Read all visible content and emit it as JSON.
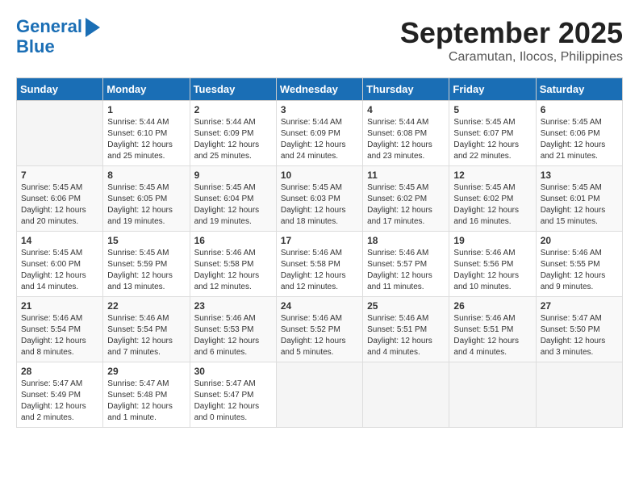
{
  "header": {
    "logo_line1": "General",
    "logo_line2": "Blue",
    "month": "September 2025",
    "location": "Caramutan, Ilocos, Philippines"
  },
  "days_of_week": [
    "Sunday",
    "Monday",
    "Tuesday",
    "Wednesday",
    "Thursday",
    "Friday",
    "Saturday"
  ],
  "weeks": [
    [
      {
        "day": "",
        "info": ""
      },
      {
        "day": "1",
        "info": "Sunrise: 5:44 AM\nSunset: 6:10 PM\nDaylight: 12 hours\nand 25 minutes."
      },
      {
        "day": "2",
        "info": "Sunrise: 5:44 AM\nSunset: 6:09 PM\nDaylight: 12 hours\nand 25 minutes."
      },
      {
        "day": "3",
        "info": "Sunrise: 5:44 AM\nSunset: 6:09 PM\nDaylight: 12 hours\nand 24 minutes."
      },
      {
        "day": "4",
        "info": "Sunrise: 5:44 AM\nSunset: 6:08 PM\nDaylight: 12 hours\nand 23 minutes."
      },
      {
        "day": "5",
        "info": "Sunrise: 5:45 AM\nSunset: 6:07 PM\nDaylight: 12 hours\nand 22 minutes."
      },
      {
        "day": "6",
        "info": "Sunrise: 5:45 AM\nSunset: 6:06 PM\nDaylight: 12 hours\nand 21 minutes."
      }
    ],
    [
      {
        "day": "7",
        "info": "Sunrise: 5:45 AM\nSunset: 6:06 PM\nDaylight: 12 hours\nand 20 minutes."
      },
      {
        "day": "8",
        "info": "Sunrise: 5:45 AM\nSunset: 6:05 PM\nDaylight: 12 hours\nand 19 minutes."
      },
      {
        "day": "9",
        "info": "Sunrise: 5:45 AM\nSunset: 6:04 PM\nDaylight: 12 hours\nand 19 minutes."
      },
      {
        "day": "10",
        "info": "Sunrise: 5:45 AM\nSunset: 6:03 PM\nDaylight: 12 hours\nand 18 minutes."
      },
      {
        "day": "11",
        "info": "Sunrise: 5:45 AM\nSunset: 6:02 PM\nDaylight: 12 hours\nand 17 minutes."
      },
      {
        "day": "12",
        "info": "Sunrise: 5:45 AM\nSunset: 6:02 PM\nDaylight: 12 hours\nand 16 minutes."
      },
      {
        "day": "13",
        "info": "Sunrise: 5:45 AM\nSunset: 6:01 PM\nDaylight: 12 hours\nand 15 minutes."
      }
    ],
    [
      {
        "day": "14",
        "info": "Sunrise: 5:45 AM\nSunset: 6:00 PM\nDaylight: 12 hours\nand 14 minutes."
      },
      {
        "day": "15",
        "info": "Sunrise: 5:45 AM\nSunset: 5:59 PM\nDaylight: 12 hours\nand 13 minutes."
      },
      {
        "day": "16",
        "info": "Sunrise: 5:46 AM\nSunset: 5:58 PM\nDaylight: 12 hours\nand 12 minutes."
      },
      {
        "day": "17",
        "info": "Sunrise: 5:46 AM\nSunset: 5:58 PM\nDaylight: 12 hours\nand 12 minutes."
      },
      {
        "day": "18",
        "info": "Sunrise: 5:46 AM\nSunset: 5:57 PM\nDaylight: 12 hours\nand 11 minutes."
      },
      {
        "day": "19",
        "info": "Sunrise: 5:46 AM\nSunset: 5:56 PM\nDaylight: 12 hours\nand 10 minutes."
      },
      {
        "day": "20",
        "info": "Sunrise: 5:46 AM\nSunset: 5:55 PM\nDaylight: 12 hours\nand 9 minutes."
      }
    ],
    [
      {
        "day": "21",
        "info": "Sunrise: 5:46 AM\nSunset: 5:54 PM\nDaylight: 12 hours\nand 8 minutes."
      },
      {
        "day": "22",
        "info": "Sunrise: 5:46 AM\nSunset: 5:54 PM\nDaylight: 12 hours\nand 7 minutes."
      },
      {
        "day": "23",
        "info": "Sunrise: 5:46 AM\nSunset: 5:53 PM\nDaylight: 12 hours\nand 6 minutes."
      },
      {
        "day": "24",
        "info": "Sunrise: 5:46 AM\nSunset: 5:52 PM\nDaylight: 12 hours\nand 5 minutes."
      },
      {
        "day": "25",
        "info": "Sunrise: 5:46 AM\nSunset: 5:51 PM\nDaylight: 12 hours\nand 4 minutes."
      },
      {
        "day": "26",
        "info": "Sunrise: 5:46 AM\nSunset: 5:51 PM\nDaylight: 12 hours\nand 4 minutes."
      },
      {
        "day": "27",
        "info": "Sunrise: 5:47 AM\nSunset: 5:50 PM\nDaylight: 12 hours\nand 3 minutes."
      }
    ],
    [
      {
        "day": "28",
        "info": "Sunrise: 5:47 AM\nSunset: 5:49 PM\nDaylight: 12 hours\nand 2 minutes."
      },
      {
        "day": "29",
        "info": "Sunrise: 5:47 AM\nSunset: 5:48 PM\nDaylight: 12 hours\nand 1 minute."
      },
      {
        "day": "30",
        "info": "Sunrise: 5:47 AM\nSunset: 5:47 PM\nDaylight: 12 hours\nand 0 minutes."
      },
      {
        "day": "",
        "info": ""
      },
      {
        "day": "",
        "info": ""
      },
      {
        "day": "",
        "info": ""
      },
      {
        "day": "",
        "info": ""
      }
    ]
  ]
}
